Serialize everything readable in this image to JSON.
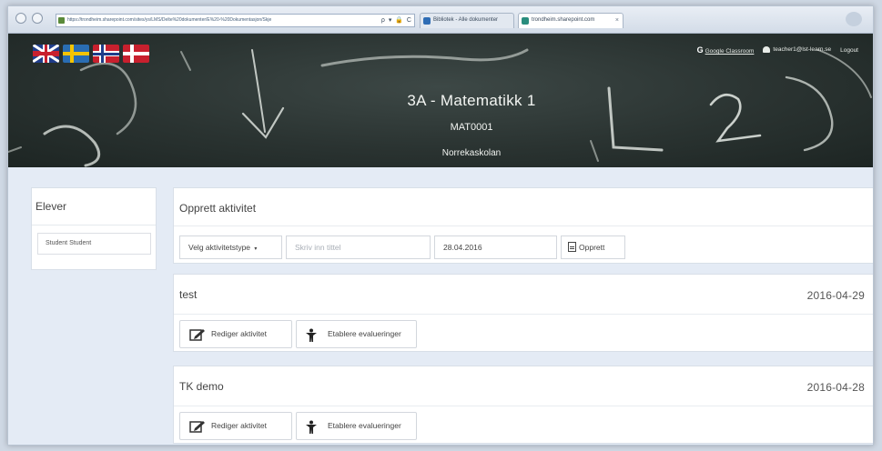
{
  "browser": {
    "address": "https://trondheim.sharepoint.com/sites/ys/LMS/Delte%20dokumenter/E%20-%20Dokumentasjon/Skje",
    "address_tools": "ρ ▾ 🔒 C",
    "tabs": [
      {
        "label": "Bibliotek - Alle dokumenter"
      },
      {
        "label": "trondheim.sharepoint.com",
        "close": "×"
      }
    ]
  },
  "header": {
    "flags": [
      "uk-flag",
      "swedish-flag",
      "norwegian-flag",
      "danish-flag"
    ],
    "google_icon": "G",
    "google_classroom": "Google Classroom",
    "user_email": "teacher1@lst-learn.se",
    "logout": "Logout",
    "course_title": "3A - Matematikk 1",
    "course_code": "MAT0001",
    "school": "Norrekaskolan"
  },
  "sidebar": {
    "title": "Elever",
    "students": [
      "Student Student"
    ]
  },
  "create": {
    "title": "Opprett aktivitet",
    "type_select": "Velg aktivitetstype",
    "caret": "▾",
    "title_placeholder": "Skriv inn tittel",
    "date_value": "28.04.2016",
    "submit": "Opprett"
  },
  "activities": [
    {
      "name": "test",
      "date": "2016-04-29",
      "edit": "Rediger aktivitet",
      "evaluate": "Etablere evalueringer"
    },
    {
      "name": "TK demo",
      "date": "2016-04-28",
      "edit": "Rediger aktivitet",
      "evaluate": "Etablere evalueringer"
    }
  ],
  "colors": {
    "header_bg": "#2a3331",
    "content_bg": "#e4ebf5",
    "chalk": "#e6ebe6"
  }
}
